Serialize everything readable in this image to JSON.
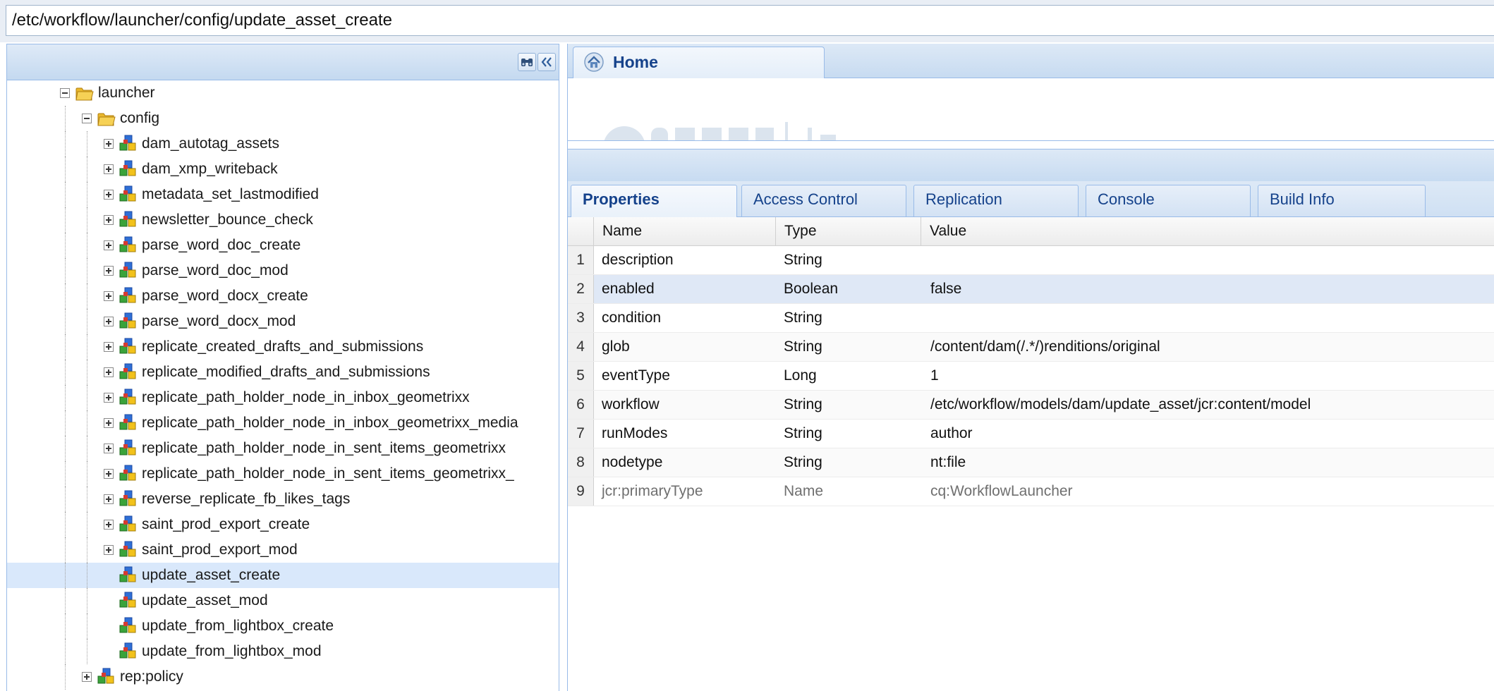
{
  "path": {
    "value": "/etc/workflow/launcher/config/update_asset_create"
  },
  "tree": {
    "nodes": [
      {
        "label": "launcher",
        "level": 0,
        "type": "folder",
        "toggle": "minus",
        "selected": false
      },
      {
        "label": "config",
        "level": 1,
        "type": "folder",
        "toggle": "minus",
        "selected": false
      },
      {
        "label": "dam_autotag_assets",
        "level": 2,
        "type": "node",
        "toggle": "plus",
        "selected": false
      },
      {
        "label": "dam_xmp_writeback",
        "level": 2,
        "type": "node",
        "toggle": "plus",
        "selected": false
      },
      {
        "label": "metadata_set_lastmodified",
        "level": 2,
        "type": "node",
        "toggle": "plus",
        "selected": false
      },
      {
        "label": "newsletter_bounce_check",
        "level": 2,
        "type": "node",
        "toggle": "plus",
        "selected": false
      },
      {
        "label": "parse_word_doc_create",
        "level": 2,
        "type": "node",
        "toggle": "plus",
        "selected": false
      },
      {
        "label": "parse_word_doc_mod",
        "level": 2,
        "type": "node",
        "toggle": "plus",
        "selected": false
      },
      {
        "label": "parse_word_docx_create",
        "level": 2,
        "type": "node",
        "toggle": "plus",
        "selected": false
      },
      {
        "label": "parse_word_docx_mod",
        "level": 2,
        "type": "node",
        "toggle": "plus",
        "selected": false
      },
      {
        "label": "replicate_created_drafts_and_submissions",
        "level": 2,
        "type": "node",
        "toggle": "plus",
        "selected": false
      },
      {
        "label": "replicate_modified_drafts_and_submissions",
        "level": 2,
        "type": "node",
        "toggle": "plus",
        "selected": false
      },
      {
        "label": "replicate_path_holder_node_in_inbox_geometrixx",
        "level": 2,
        "type": "node",
        "toggle": "plus",
        "selected": false
      },
      {
        "label": "replicate_path_holder_node_in_inbox_geometrixx_media",
        "level": 2,
        "type": "node",
        "toggle": "plus",
        "selected": false
      },
      {
        "label": "replicate_path_holder_node_in_sent_items_geometrixx",
        "level": 2,
        "type": "node",
        "toggle": "plus",
        "selected": false
      },
      {
        "label": "replicate_path_holder_node_in_sent_items_geometrixx_",
        "level": 2,
        "type": "node",
        "toggle": "plus",
        "selected": false
      },
      {
        "label": "reverse_replicate_fb_likes_tags",
        "level": 2,
        "type": "node",
        "toggle": "plus",
        "selected": false
      },
      {
        "label": "saint_prod_export_create",
        "level": 2,
        "type": "node",
        "toggle": "plus",
        "selected": false
      },
      {
        "label": "saint_prod_export_mod",
        "level": 2,
        "type": "node",
        "toggle": "plus",
        "selected": false
      },
      {
        "label": "update_asset_create",
        "level": 2,
        "type": "node",
        "toggle": "none",
        "selected": true
      },
      {
        "label": "update_asset_mod",
        "level": 2,
        "type": "node",
        "toggle": "none",
        "selected": false
      },
      {
        "label": "update_from_lightbox_create",
        "level": 2,
        "type": "node",
        "toggle": "none",
        "selected": false
      },
      {
        "label": "update_from_lightbox_mod",
        "level": 2,
        "type": "node",
        "toggle": "none",
        "selected": false
      },
      {
        "label": "rep:policy",
        "level": 1,
        "type": "node",
        "toggle": "plus",
        "selected": false
      }
    ]
  },
  "home_tab": {
    "label": "Home"
  },
  "tabs": [
    {
      "label": "Properties",
      "active": true
    },
    {
      "label": "Access Control",
      "active": false
    },
    {
      "label": "Replication",
      "active": false
    },
    {
      "label": "Console",
      "active": false
    },
    {
      "label": "Build Info",
      "active": false
    }
  ],
  "grid": {
    "columns": [
      "Name",
      "Type",
      "Value"
    ],
    "rows": [
      {
        "num": "1",
        "name": "description",
        "type": "String",
        "value": "",
        "selected": false,
        "dim": false
      },
      {
        "num": "2",
        "name": "enabled",
        "type": "Boolean",
        "value": "false",
        "selected": true,
        "dim": false
      },
      {
        "num": "3",
        "name": "condition",
        "type": "String",
        "value": "",
        "selected": false,
        "dim": false
      },
      {
        "num": "4",
        "name": "glob",
        "type": "String",
        "value": "/content/dam(/.*/)renditions/original",
        "selected": false,
        "dim": false
      },
      {
        "num": "5",
        "name": "eventType",
        "type": "Long",
        "value": "1",
        "selected": false,
        "dim": false
      },
      {
        "num": "6",
        "name": "workflow",
        "type": "String",
        "value": "/etc/workflow/models/dam/update_asset/jcr:content/model",
        "selected": false,
        "dim": false
      },
      {
        "num": "7",
        "name": "runModes",
        "type": "String",
        "value": "author",
        "selected": false,
        "dim": false
      },
      {
        "num": "8",
        "name": "nodetype",
        "type": "String",
        "value": "nt:file",
        "selected": false,
        "dim": false
      },
      {
        "num": "9",
        "name": "jcr:primaryType",
        "type": "Name",
        "value": "cq:WorkflowLauncher",
        "selected": false,
        "dim": true
      }
    ]
  },
  "colors": {
    "accent": "#15428b",
    "panel_border": "#99bbe8",
    "selection": "#d9e8fb"
  },
  "icons": {
    "folder": "folder-icon",
    "node": "node-icon",
    "home": "home-icon",
    "find": "binoculars-icon",
    "collapse": "double-chevron-left-icon"
  }
}
